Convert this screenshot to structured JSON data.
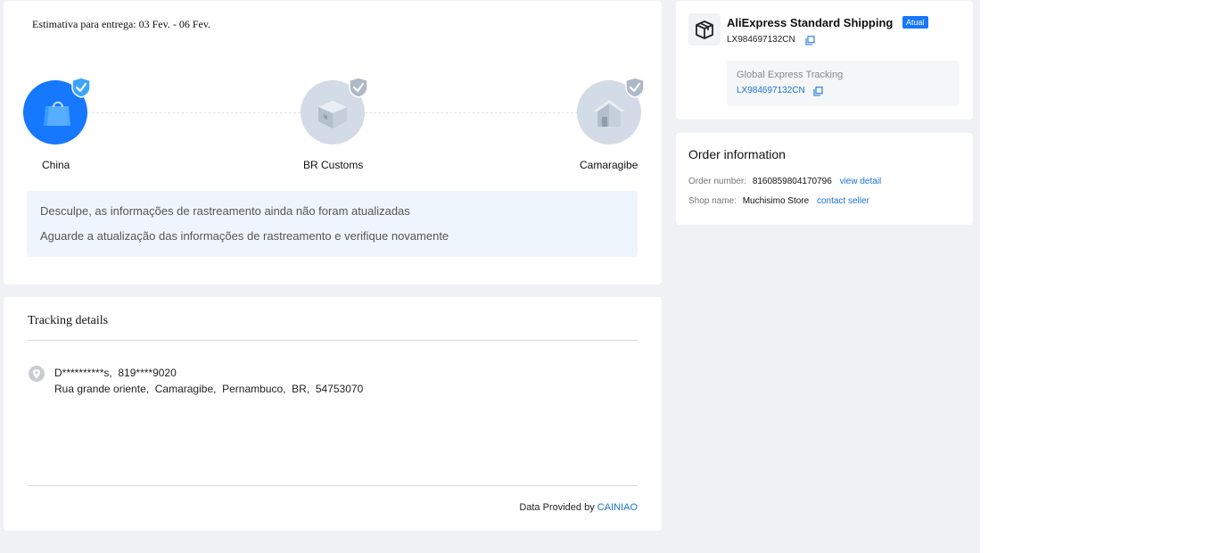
{
  "delivery": {
    "eta_label": "Estimativa para entrega: 03 Fev. - 06 Fev."
  },
  "progress": {
    "steps": [
      {
        "label": "China",
        "status": "done",
        "icon": "shopping-bag-icon"
      },
      {
        "label": "BR Customs",
        "status": "pending",
        "icon": "package-box-icon"
      },
      {
        "label": "Camaragibe",
        "status": "pending",
        "icon": "house-icon"
      }
    ],
    "colors": {
      "done": "#1677ff",
      "pending": "#d3dbe6",
      "badge_done": "#3aa5ff",
      "badge_pending": "#aeb8c6"
    }
  },
  "notice": {
    "line1": "Desculpe, as informações de rastreamento ainda não foram atualizadas",
    "line2": "Aguarde a atualização das informações de rastreamento e verifique novamente"
  },
  "tracking_details": {
    "title": "Tracking details",
    "recipient_name": "D**********s,",
    "recipient_phone": "819****9020",
    "address": {
      "street": "Rua grande oriente,",
      "city": "Camaragibe,",
      "state": "Pernambuco,",
      "country": "BR,",
      "zip": "54753070"
    },
    "provider_prefix": "Data Provided by",
    "provider_name": "CAINIAO"
  },
  "shipping": {
    "carrier": "AliExpress Standard Shipping",
    "badge": "Atual",
    "tracking_number": "LX984697132CN",
    "global_label": "Global Express Tracking",
    "global_number": "LX984697132CN"
  },
  "order_info": {
    "title": "Order information",
    "order_number_label": "Order number:",
    "order_number": "8160859804170796",
    "view_detail": "view detail",
    "shop_name_label": "Shop name:",
    "shop_name": "Muchisimo Store",
    "contact_seller": "contact seller"
  }
}
